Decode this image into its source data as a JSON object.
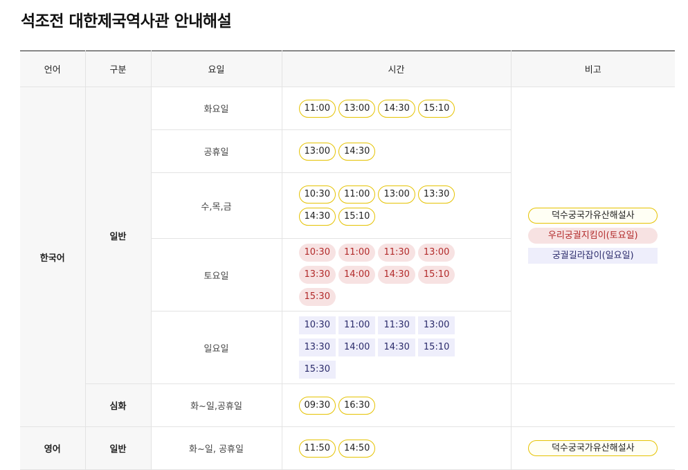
{
  "title": "석조전 대한제국역사관 안내해설",
  "headers": [
    "언어",
    "구분",
    "요일",
    "시간",
    "비고"
  ],
  "korean": {
    "language": "한국어",
    "general_label": "일반",
    "advanced_label": "심화",
    "rows": [
      {
        "day": "화요일",
        "times": [
          "11:00",
          "13:00",
          "14:30",
          "15:10"
        ]
      },
      {
        "day": "공휴일",
        "times": [
          "13:00",
          "14:30"
        ]
      },
      {
        "day": "수,목,금",
        "times": [
          "10:30",
          "11:00",
          "13:00",
          "13:30",
          "14:30",
          "15:10"
        ]
      },
      {
        "day": "토요일",
        "times": [
          "10:30",
          "11:00",
          "11:30",
          "13:00",
          "13:30",
          "14:00",
          "14:30",
          "15:10",
          "15:30"
        ]
      },
      {
        "day": "일요일",
        "times": [
          "10:30",
          "11:00",
          "11:30",
          "13:00",
          "13:30",
          "14:00",
          "14:30",
          "15:10",
          "15:30"
        ]
      }
    ],
    "advanced_row": {
      "day": "화~일,공휴일",
      "times": [
        "09:30",
        "16:30"
      ]
    },
    "notes": [
      "덕수궁국가유산해설사",
      "우리궁궐지킴이(토요일)",
      "궁궐길라잡이(일요일)"
    ]
  },
  "english": {
    "language": "영어",
    "general_label": "일반",
    "row": {
      "day": "화~일, 공휴일",
      "times": [
        "11:50",
        "14:50"
      ]
    },
    "notes": [
      "덕수궁국가유산해설사"
    ]
  },
  "colors": {
    "chip_border": "#e5c200",
    "saturday_bg": "#f7e2e2",
    "saturday_text": "#b22a2a",
    "sunday_bg": "#eeeefb",
    "sunday_text": "#2a2a6a"
  }
}
